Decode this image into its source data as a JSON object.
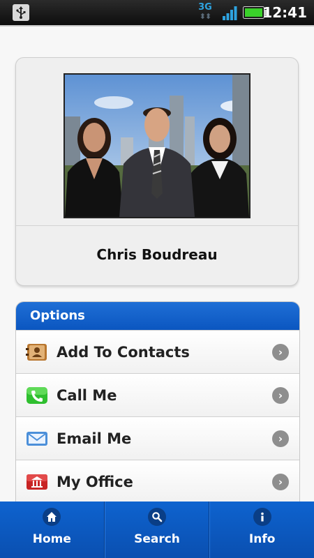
{
  "status_bar": {
    "time": "12:41",
    "network": "3G",
    "icons": [
      "usb-icon",
      "network-3g-icon",
      "signal-icon",
      "battery-icon"
    ]
  },
  "profile": {
    "name": "Chris Boudreau",
    "photo": "team-photo"
  },
  "options": {
    "header": "Options",
    "items": [
      {
        "label": "Add To Contacts",
        "icon": "address-book-icon"
      },
      {
        "label": "Call Me",
        "icon": "phone-icon"
      },
      {
        "label": "Email Me",
        "icon": "envelope-icon"
      },
      {
        "label": "My Office",
        "icon": "office-building-icon"
      }
    ]
  },
  "nav": {
    "items": [
      {
        "label": "Home",
        "icon": "home-icon"
      },
      {
        "label": "Search",
        "icon": "search-icon"
      },
      {
        "label": "Info",
        "icon": "info-icon"
      }
    ]
  },
  "colors": {
    "accent": "#0b56c0",
    "status_bar": "#111111",
    "battery": "#3ad12a",
    "chevron": "#8e8e8e"
  }
}
